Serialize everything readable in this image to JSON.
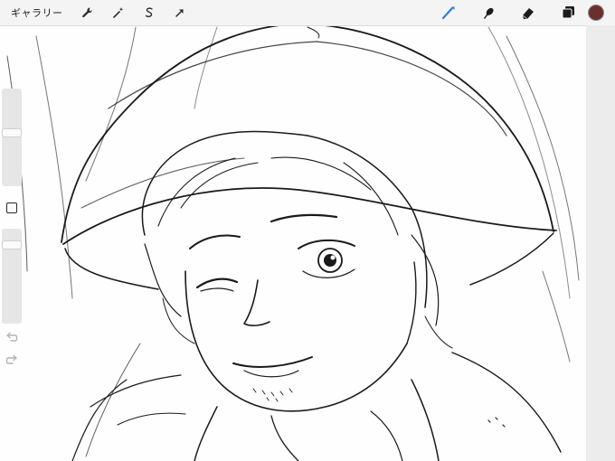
{
  "toolbar": {
    "gallery_label": "ギャラリー",
    "left_tools": [
      {
        "name": "actions",
        "icon": "wrench-icon"
      },
      {
        "name": "adjustments",
        "icon": "magic-wand-icon"
      },
      {
        "name": "selection",
        "icon": "selection-s-icon"
      },
      {
        "name": "transform",
        "icon": "arrow-cursor-icon"
      }
    ],
    "right_tools": [
      {
        "name": "brush",
        "icon": "brush-icon",
        "active": true
      },
      {
        "name": "smudge",
        "icon": "smudge-icon",
        "active": false
      },
      {
        "name": "eraser",
        "icon": "eraser-icon",
        "active": false
      },
      {
        "name": "layers",
        "icon": "layers-icon",
        "active": false
      }
    ],
    "active_color": "#6b2f2f",
    "accent_color": "#2f7fe0"
  },
  "sidebar": {
    "brush_size_level": 0.55,
    "opacity_level": 0.86,
    "modify_icon": "square-icon",
    "undo_icon": "undo-icon",
    "redo_icon": "redo-icon"
  }
}
